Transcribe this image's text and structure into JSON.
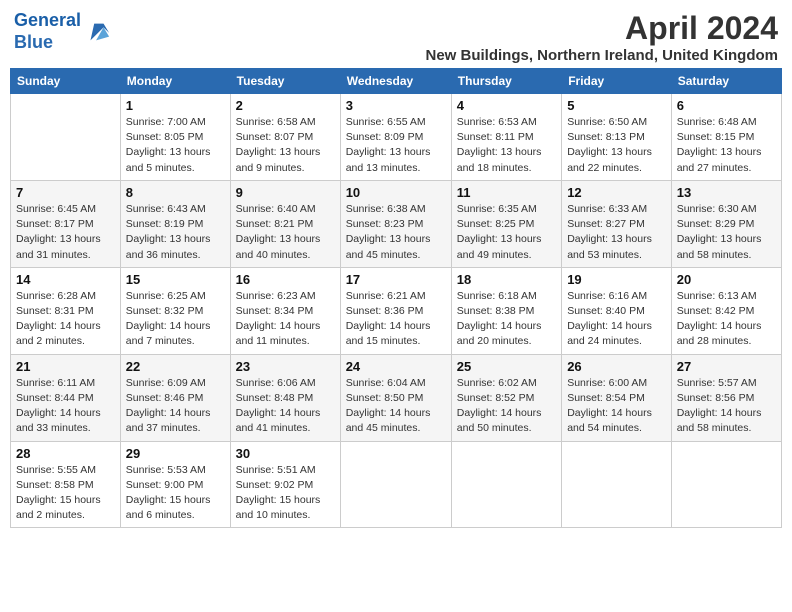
{
  "header": {
    "logo_line1": "General",
    "logo_line2": "Blue",
    "title": "April 2024",
    "subtitle": "New Buildings, Northern Ireland, United Kingdom"
  },
  "columns": [
    "Sunday",
    "Monday",
    "Tuesday",
    "Wednesday",
    "Thursday",
    "Friday",
    "Saturday"
  ],
  "weeks": [
    [
      {
        "num": "",
        "info": ""
      },
      {
        "num": "1",
        "info": "Sunrise: 7:00 AM\nSunset: 8:05 PM\nDaylight: 13 hours\nand 5 minutes."
      },
      {
        "num": "2",
        "info": "Sunrise: 6:58 AM\nSunset: 8:07 PM\nDaylight: 13 hours\nand 9 minutes."
      },
      {
        "num": "3",
        "info": "Sunrise: 6:55 AM\nSunset: 8:09 PM\nDaylight: 13 hours\nand 13 minutes."
      },
      {
        "num": "4",
        "info": "Sunrise: 6:53 AM\nSunset: 8:11 PM\nDaylight: 13 hours\nand 18 minutes."
      },
      {
        "num": "5",
        "info": "Sunrise: 6:50 AM\nSunset: 8:13 PM\nDaylight: 13 hours\nand 22 minutes."
      },
      {
        "num": "6",
        "info": "Sunrise: 6:48 AM\nSunset: 8:15 PM\nDaylight: 13 hours\nand 27 minutes."
      }
    ],
    [
      {
        "num": "7",
        "info": "Sunrise: 6:45 AM\nSunset: 8:17 PM\nDaylight: 13 hours\nand 31 minutes."
      },
      {
        "num": "8",
        "info": "Sunrise: 6:43 AM\nSunset: 8:19 PM\nDaylight: 13 hours\nand 36 minutes."
      },
      {
        "num": "9",
        "info": "Sunrise: 6:40 AM\nSunset: 8:21 PM\nDaylight: 13 hours\nand 40 minutes."
      },
      {
        "num": "10",
        "info": "Sunrise: 6:38 AM\nSunset: 8:23 PM\nDaylight: 13 hours\nand 45 minutes."
      },
      {
        "num": "11",
        "info": "Sunrise: 6:35 AM\nSunset: 8:25 PM\nDaylight: 13 hours\nand 49 minutes."
      },
      {
        "num": "12",
        "info": "Sunrise: 6:33 AM\nSunset: 8:27 PM\nDaylight: 13 hours\nand 53 minutes."
      },
      {
        "num": "13",
        "info": "Sunrise: 6:30 AM\nSunset: 8:29 PM\nDaylight: 13 hours\nand 58 minutes."
      }
    ],
    [
      {
        "num": "14",
        "info": "Sunrise: 6:28 AM\nSunset: 8:31 PM\nDaylight: 14 hours\nand 2 minutes."
      },
      {
        "num": "15",
        "info": "Sunrise: 6:25 AM\nSunset: 8:32 PM\nDaylight: 14 hours\nand 7 minutes."
      },
      {
        "num": "16",
        "info": "Sunrise: 6:23 AM\nSunset: 8:34 PM\nDaylight: 14 hours\nand 11 minutes."
      },
      {
        "num": "17",
        "info": "Sunrise: 6:21 AM\nSunset: 8:36 PM\nDaylight: 14 hours\nand 15 minutes."
      },
      {
        "num": "18",
        "info": "Sunrise: 6:18 AM\nSunset: 8:38 PM\nDaylight: 14 hours\nand 20 minutes."
      },
      {
        "num": "19",
        "info": "Sunrise: 6:16 AM\nSunset: 8:40 PM\nDaylight: 14 hours\nand 24 minutes."
      },
      {
        "num": "20",
        "info": "Sunrise: 6:13 AM\nSunset: 8:42 PM\nDaylight: 14 hours\nand 28 minutes."
      }
    ],
    [
      {
        "num": "21",
        "info": "Sunrise: 6:11 AM\nSunset: 8:44 PM\nDaylight: 14 hours\nand 33 minutes."
      },
      {
        "num": "22",
        "info": "Sunrise: 6:09 AM\nSunset: 8:46 PM\nDaylight: 14 hours\nand 37 minutes."
      },
      {
        "num": "23",
        "info": "Sunrise: 6:06 AM\nSunset: 8:48 PM\nDaylight: 14 hours\nand 41 minutes."
      },
      {
        "num": "24",
        "info": "Sunrise: 6:04 AM\nSunset: 8:50 PM\nDaylight: 14 hours\nand 45 minutes."
      },
      {
        "num": "25",
        "info": "Sunrise: 6:02 AM\nSunset: 8:52 PM\nDaylight: 14 hours\nand 50 minutes."
      },
      {
        "num": "26",
        "info": "Sunrise: 6:00 AM\nSunset: 8:54 PM\nDaylight: 14 hours\nand 54 minutes."
      },
      {
        "num": "27",
        "info": "Sunrise: 5:57 AM\nSunset: 8:56 PM\nDaylight: 14 hours\nand 58 minutes."
      }
    ],
    [
      {
        "num": "28",
        "info": "Sunrise: 5:55 AM\nSunset: 8:58 PM\nDaylight: 15 hours\nand 2 minutes."
      },
      {
        "num": "29",
        "info": "Sunrise: 5:53 AM\nSunset: 9:00 PM\nDaylight: 15 hours\nand 6 minutes."
      },
      {
        "num": "30",
        "info": "Sunrise: 5:51 AM\nSunset: 9:02 PM\nDaylight: 15 hours\nand 10 minutes."
      },
      {
        "num": "",
        "info": ""
      },
      {
        "num": "",
        "info": ""
      },
      {
        "num": "",
        "info": ""
      },
      {
        "num": "",
        "info": ""
      }
    ]
  ]
}
